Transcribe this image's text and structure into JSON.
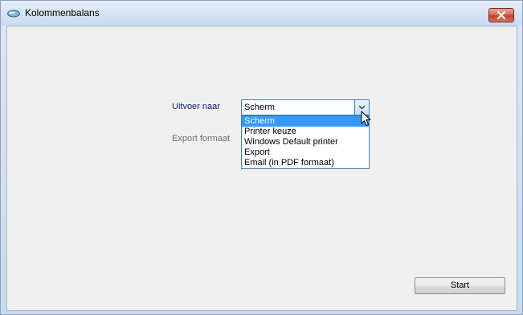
{
  "window": {
    "title": "Kolommenbalans"
  },
  "form": {
    "output_label": "Uitvoer naar",
    "export_format_label": "Export formaat",
    "output_combo": {
      "selected_value": "Scherm",
      "options": [
        "Scherm",
        "Printer keuze",
        "Windows Default printer",
        "Export",
        "Email (in PDF formaat)"
      ],
      "highlighted_index": 0
    },
    "start_button_label": "Start"
  },
  "icons": {
    "app": "app-icon",
    "close": "close-icon",
    "dropdown_arrow": "chevron-down-icon",
    "cursor": "mouse-pointer-icon"
  },
  "colors": {
    "close_button": "#c5412a",
    "selection_highlight": "#3399ff",
    "label_text": "#0a1f7a",
    "disabled_label_text": "#6d6d6d"
  }
}
